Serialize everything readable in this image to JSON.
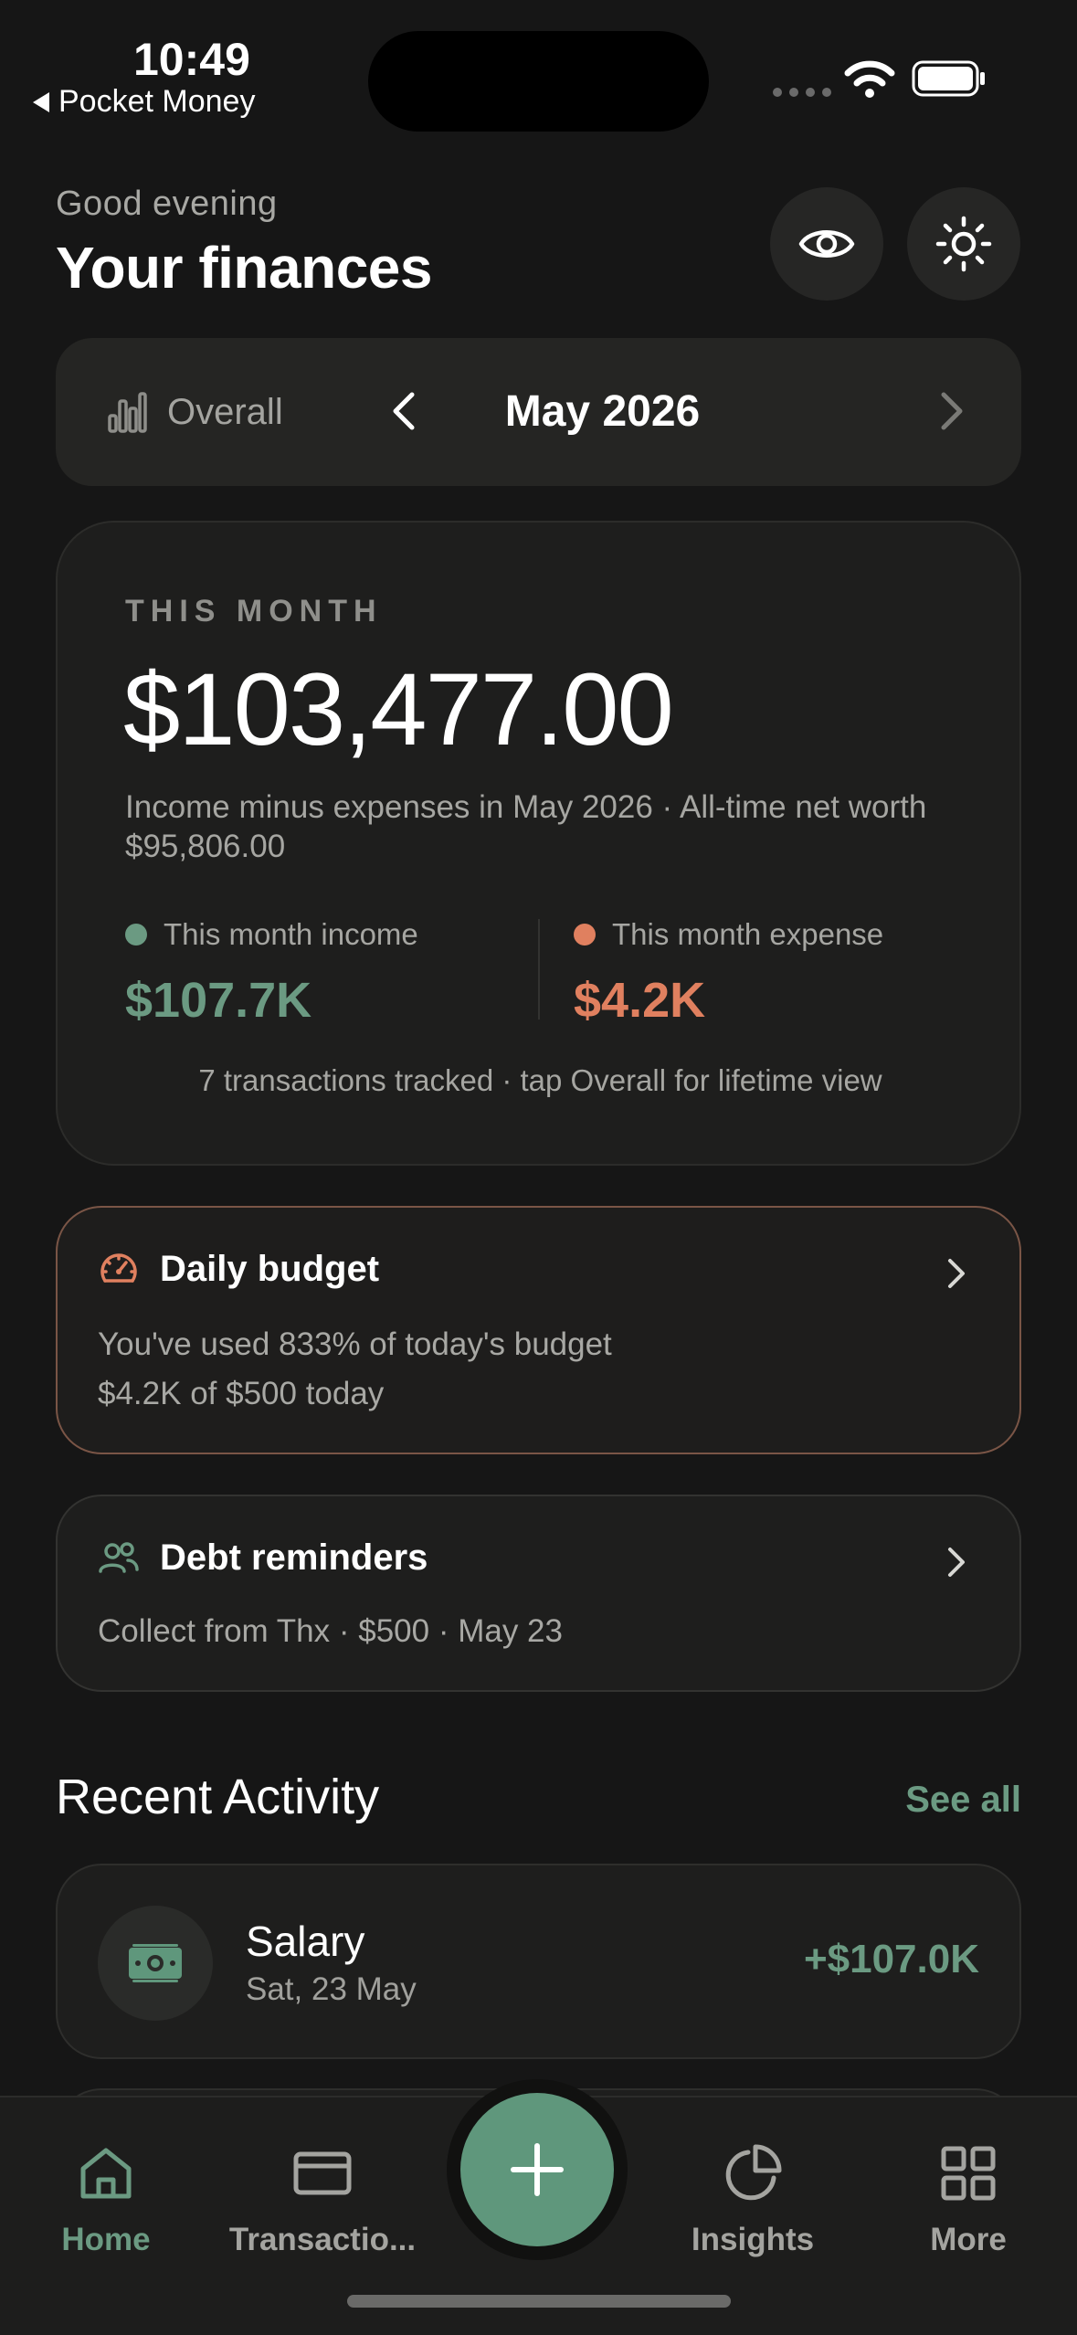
{
  "status": {
    "time": "10:49",
    "back_app": "Pocket Money"
  },
  "header": {
    "greeting": "Good evening",
    "title": "Your finances"
  },
  "period": {
    "scope_label": "Overall",
    "month": "May 2026"
  },
  "summary": {
    "label": "THIS MONTH",
    "net_amount": "$103,477.00",
    "description": "Income minus expenses in May 2026 · All-time net worth $95,806.00",
    "income_label": "This month income",
    "income_value": "$107.7K",
    "expense_label": "This month expense",
    "expense_value": "$4.2K",
    "footer": "7 transactions tracked · tap Overall for lifetime view"
  },
  "daily_budget": {
    "title": "Daily budget",
    "line1": "You've used 833% of today's budget",
    "line2": "$4.2K of $500 today"
  },
  "debt_reminders": {
    "title": "Debt reminders",
    "line1": "Collect from Thx · $500 · May 23"
  },
  "recent": {
    "title": "Recent Activity",
    "see_all": "See all",
    "items": [
      {
        "name": "Salary",
        "date": "Sat, 23 May",
        "amount": "+$107.0K",
        "icon": "money-icon"
      }
    ]
  },
  "tabs": {
    "home": "Home",
    "transactions": "Transactio...",
    "insights": "Insights",
    "more": "More"
  },
  "colors": {
    "accent_green": "#6b9a82",
    "expense_orange": "#e0805f",
    "fab": "#5f977c"
  }
}
